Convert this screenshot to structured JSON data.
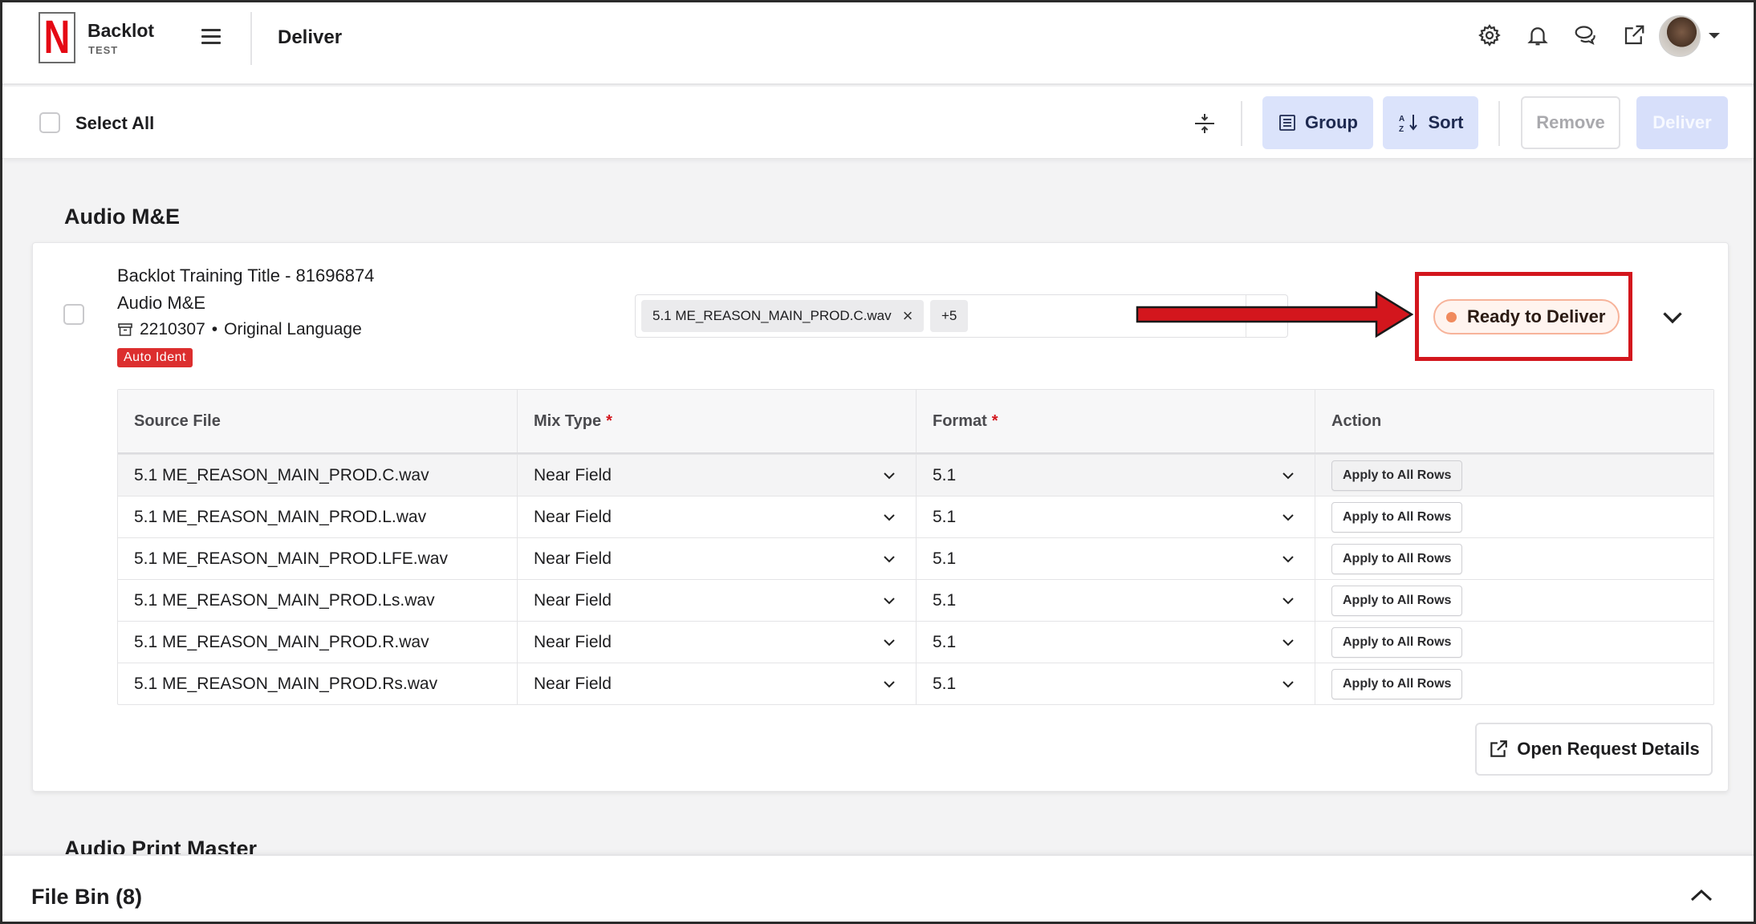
{
  "app": {
    "name": "Backlot",
    "env": "TEST",
    "logo_letter": "N",
    "brand_color": "#e50914"
  },
  "header": {
    "page_title": "Deliver",
    "icons": [
      "gear-icon",
      "bell-icon",
      "chat-icon",
      "external-link-icon"
    ]
  },
  "toolbar": {
    "select_all_label": "Select All",
    "group_label": "Group",
    "sort_label": "Sort",
    "remove_label": "Remove",
    "deliver_label": "Deliver"
  },
  "sections": [
    {
      "title": "Audio M&E",
      "item": {
        "title": "Backlot Training Title - 81696874",
        "subtitle": "Audio M&E",
        "request_id": "2210307",
        "language": "Original Language",
        "tag": "Auto Ident",
        "selected_file_chip": "5.1 ME_REASON_MAIN_PROD.C.wav",
        "more_chip": "+5",
        "status": "Ready to Deliver",
        "status_color": "#f08a5d",
        "table": {
          "headers": {
            "source": "Source File",
            "mix": "Mix Type",
            "format": "Format",
            "action": "Action"
          },
          "required_marker": "*",
          "rows": [
            {
              "source": "5.1 ME_REASON_MAIN_PROD.C.wav",
              "mix": "Near Field",
              "format": "5.1",
              "action": "Apply to All Rows"
            },
            {
              "source": "5.1 ME_REASON_MAIN_PROD.L.wav",
              "mix": "Near Field",
              "format": "5.1",
              "action": "Apply to All Rows"
            },
            {
              "source": "5.1 ME_REASON_MAIN_PROD.LFE.wav",
              "mix": "Near Field",
              "format": "5.1",
              "action": "Apply to All Rows"
            },
            {
              "source": "5.1 ME_REASON_MAIN_PROD.Ls.wav",
              "mix": "Near Field",
              "format": "5.1",
              "action": "Apply to All Rows"
            },
            {
              "source": "5.1 ME_REASON_MAIN_PROD.R.wav",
              "mix": "Near Field",
              "format": "5.1",
              "action": "Apply to All Rows"
            },
            {
              "source": "5.1 ME_REASON_MAIN_PROD.Rs.wav",
              "mix": "Near Field",
              "format": "5.1",
              "action": "Apply to All Rows"
            }
          ]
        },
        "open_request_label": "Open Request Details"
      }
    },
    {
      "title": "Audio Print Master"
    }
  ],
  "file_bin": {
    "label": "File Bin (8)"
  },
  "annotation": {
    "arrow_color": "#d3161d",
    "highlight_color": "#d3161d"
  }
}
